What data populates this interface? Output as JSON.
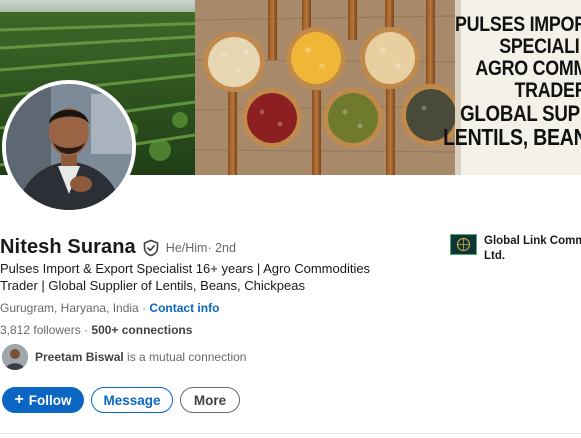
{
  "banner": {
    "lines": [
      "PULSES IMPORT",
      "SPECIALI",
      "AGRO COMM",
      "TRADER",
      "GLOBAL SUPP",
      "LENTILS, BEANS, C"
    ]
  },
  "profile": {
    "name": "Nitesh Surana",
    "pronouns": "He/Him",
    "degree": "· 2nd",
    "headline": "Pulses Import & Export Specialist 16+ years | Agro Commodities Trader | Global Supplier of Lentils, Beans, Chickpeas",
    "location": "Gurugram, Haryana, India",
    "location_sep": " · ",
    "contact_info": "Contact info",
    "followers": "3,812 followers",
    "stats_sep": " · ",
    "connections": "500+ connections",
    "mutual_name": "Preetam Biswal",
    "mutual_suffix": " is a mutual connection"
  },
  "actions": {
    "follow_plus": "+",
    "follow": "Follow",
    "message": "Message",
    "more": "More"
  },
  "company": {
    "name": "Global Link Comm Ltd."
  },
  "icons": {
    "verified": "shield-check-icon",
    "follow": "plus-icon"
  },
  "colors": {
    "accent": "#0a66c2"
  }
}
